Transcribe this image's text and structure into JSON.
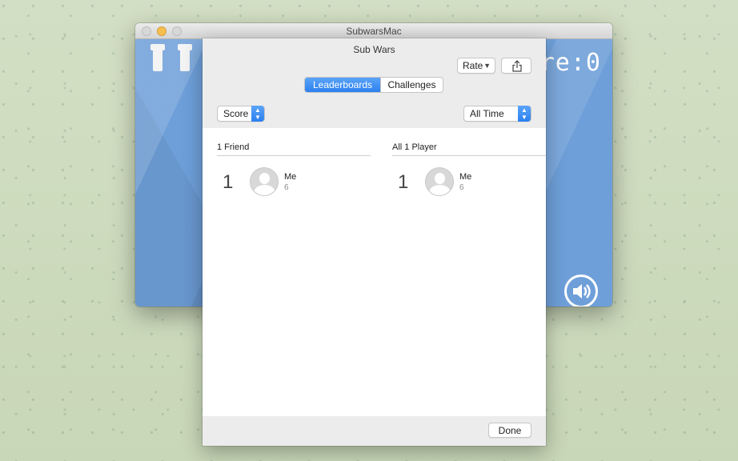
{
  "window": {
    "title": "SubwarsMac"
  },
  "game": {
    "score_text": "re:0"
  },
  "sheet": {
    "title": "Sub Wars",
    "rate_label": "Rate",
    "tabs": [
      {
        "label": "Leaderboards",
        "active": true
      },
      {
        "label": "Challenges",
        "active": false
      }
    ],
    "score_filter": "Score",
    "time_filter": "All Time",
    "columns": [
      {
        "header": "1 Friend",
        "entries": [
          {
            "rank": "1",
            "name": "Me",
            "score": "6"
          }
        ]
      },
      {
        "header": "All 1 Player",
        "entries": [
          {
            "rank": "1",
            "name": "Me",
            "score": "6"
          }
        ]
      }
    ],
    "done_label": "Done"
  },
  "colors": {
    "accent": "#2c80ef",
    "game_bg": "#6e9fd9",
    "traffic_min": "#f5be4f"
  },
  "icons": [
    "pause-icon",
    "speaker-icon",
    "share-icon",
    "chevron-down-icon",
    "up-down-arrows-icon",
    "avatar-placeholder-icon"
  ]
}
